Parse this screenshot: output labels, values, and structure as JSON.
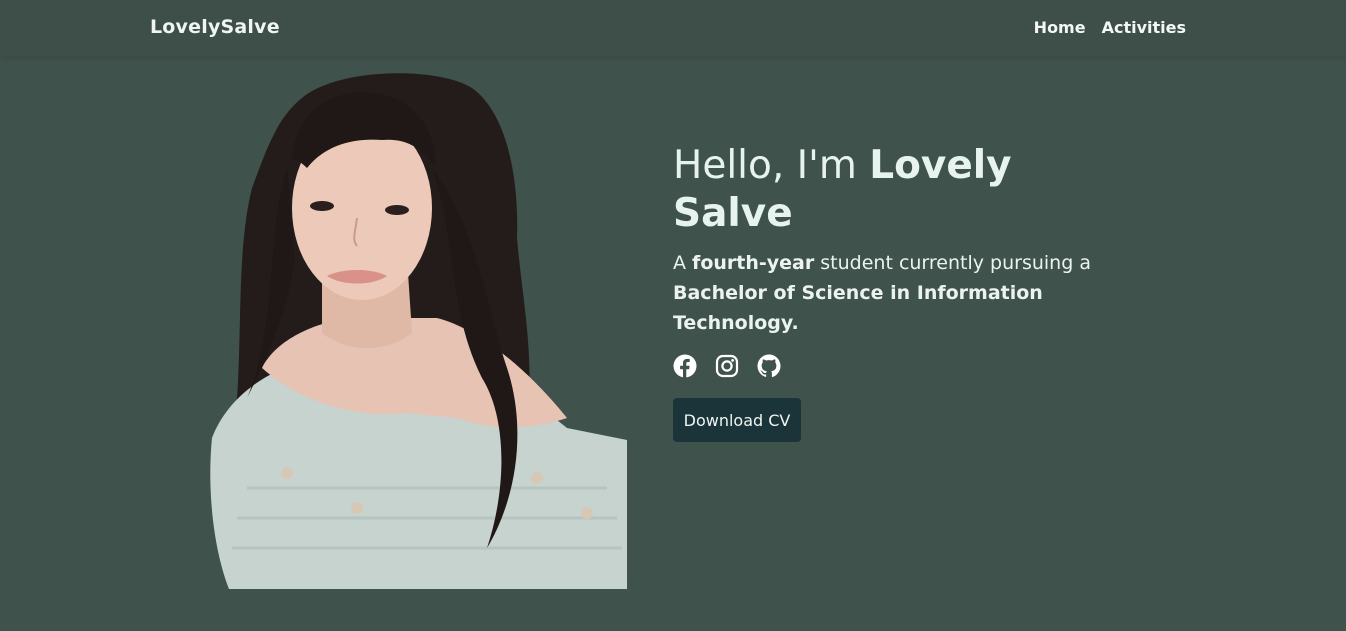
{
  "nav": {
    "brand": "LovelySalve",
    "links": [
      {
        "label": "Home"
      },
      {
        "label": "Activities"
      }
    ]
  },
  "hero": {
    "greeting": "Hello, I'm ",
    "name": "Lovely Salve",
    "sub_prefix": "A ",
    "sub_year": "fourth-year",
    "sub_mid": " student currently pursuing a ",
    "sub_degree": "Bachelor of Science in Information Technology.",
    "cv_label": "Download CV"
  },
  "socials": [
    {
      "icon": "facebook-icon"
    },
    {
      "icon": "instagram-icon"
    },
    {
      "icon": "github-icon"
    }
  ],
  "colors": {
    "background": "#40524c",
    "navbar": "#3e4f49",
    "button": "#1b3439",
    "text": "#e9f1ee"
  }
}
